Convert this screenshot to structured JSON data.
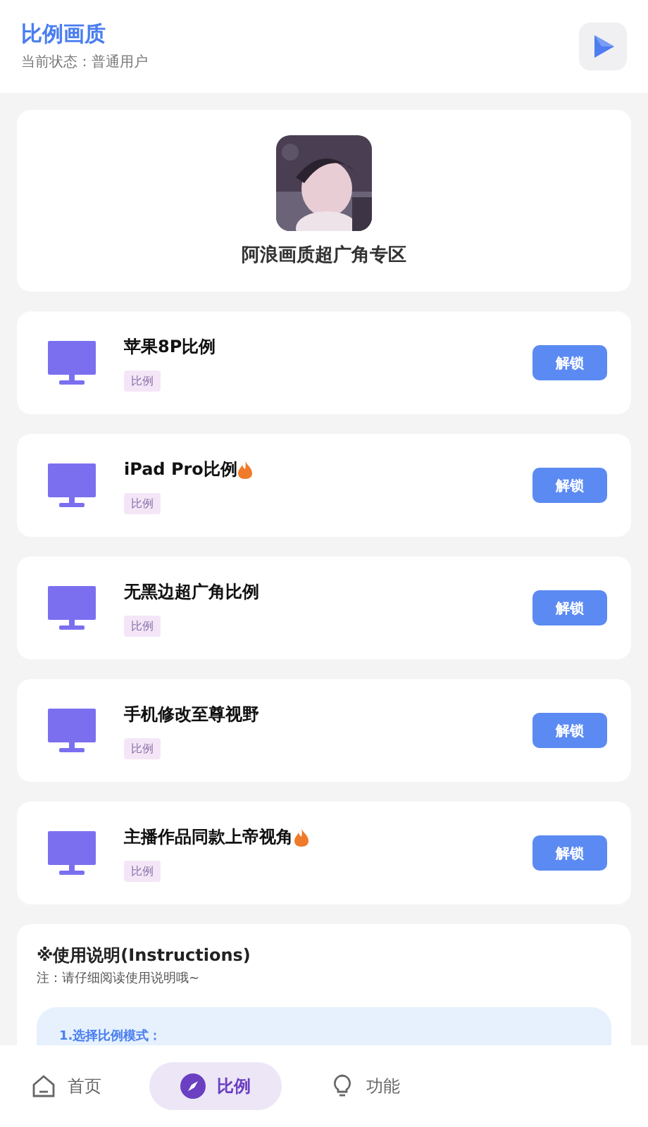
{
  "header": {
    "title": "比例画质",
    "status": "当前状态：普通用户"
  },
  "hero": {
    "title": "阿浪画质超广角专区"
  },
  "items": [
    {
      "name": "苹果8P比例",
      "hot": false,
      "tag": "比例",
      "button": "解锁"
    },
    {
      "name": "iPad Pro比例",
      "hot": true,
      "tag": "比例",
      "button": "解锁"
    },
    {
      "name": "无黑边超广角比例",
      "hot": false,
      "tag": "比例",
      "button": "解锁"
    },
    {
      "name": "手机修改至尊视野",
      "hot": false,
      "tag": "比例",
      "button": "解锁"
    },
    {
      "name": "主播作品同款上帝视角",
      "hot": true,
      "tag": "比例",
      "button": "解锁"
    }
  ],
  "instructions": {
    "title": "※使用说明(Instructions)",
    "note": "注：请仔细阅读使用说明哦~",
    "steps": [
      "1.选择比例模式："
    ]
  },
  "tabs": [
    {
      "kind": "home",
      "label": "首页",
      "selected": false
    },
    {
      "kind": "compass",
      "label": "比例",
      "selected": true
    },
    {
      "kind": "bulb",
      "label": "功能",
      "selected": false
    }
  ]
}
